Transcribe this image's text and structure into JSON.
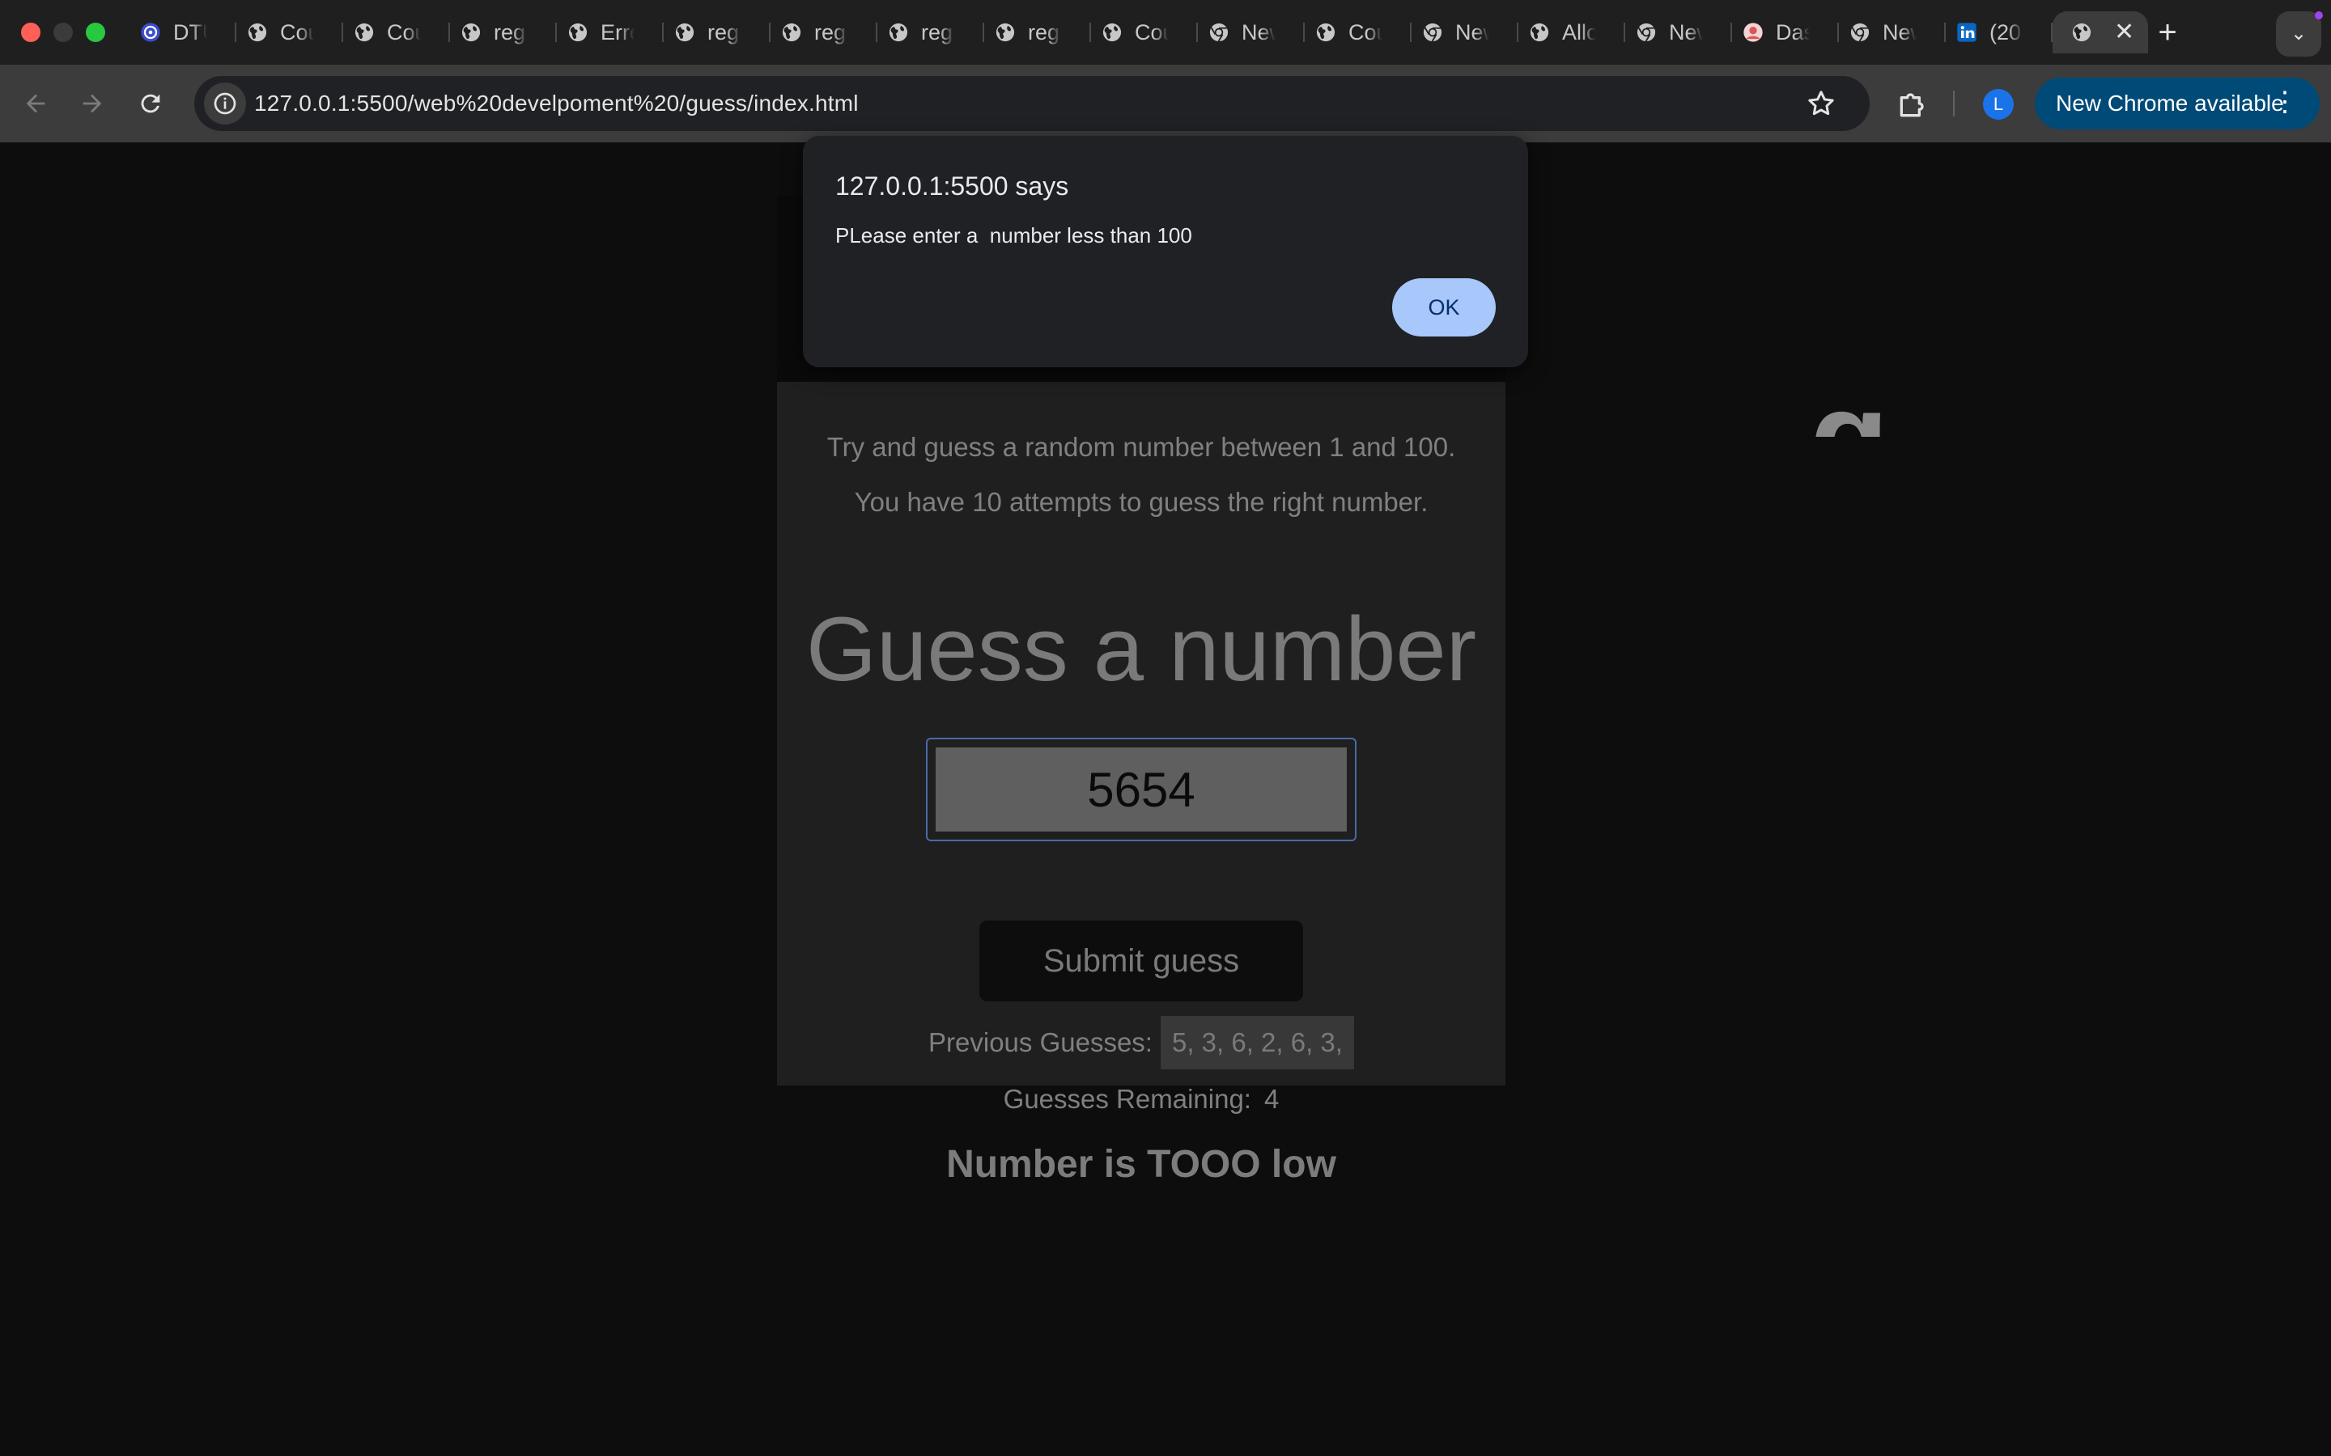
{
  "browser": {
    "tabs": [
      {
        "label": "DTU",
        "icon": "target-favicon-icon"
      },
      {
        "label": "Cou",
        "icon": "globe-favicon-icon"
      },
      {
        "label": "Cou",
        "icon": "globe-favicon-icon"
      },
      {
        "label": "reg",
        "icon": "globe-favicon-icon"
      },
      {
        "label": "Erro",
        "icon": "globe-favicon-icon"
      },
      {
        "label": "reg",
        "icon": "globe-favicon-icon"
      },
      {
        "label": "reg",
        "icon": "globe-favicon-icon"
      },
      {
        "label": "reg",
        "icon": "globe-favicon-icon"
      },
      {
        "label": "reg",
        "icon": "globe-favicon-icon"
      },
      {
        "label": "Cou",
        "icon": "globe-favicon-icon"
      },
      {
        "label": "New",
        "icon": "chrome-favicon-icon"
      },
      {
        "label": "Cou",
        "icon": "globe-favicon-icon"
      },
      {
        "label": "New",
        "icon": "chrome-favicon-icon"
      },
      {
        "label": "Allo",
        "icon": "globe-favicon-icon"
      },
      {
        "label": "New",
        "icon": "chrome-favicon-icon"
      },
      {
        "label": "Das",
        "icon": "avatar-favicon-icon"
      },
      {
        "label": "New",
        "icon": "chrome-favicon-icon"
      },
      {
        "label": "(20",
        "icon": "linkedin-favicon-icon"
      }
    ],
    "active_tab_close": "✕",
    "new_tab": "+",
    "tab_search": "⌄",
    "url": "127.0.0.1:5500/web%20develpoment%20/guess/index.html",
    "profile_initial": "L",
    "update_label": "New Chrome available",
    "update_menu": "⋮",
    "colors": {
      "tab_strip": "#1f1f1f",
      "toolbar": "#3c3c3c",
      "omnibox": "#202124",
      "update_button": "#004a77"
    }
  },
  "page": {
    "intro_line1": "Try and guess a random number between 1 and 100.",
    "intro_line2": "You have 10 attempts to guess the right number.",
    "heading": "Guess a number",
    "guess_value": "5654",
    "submit_label": "Submit guess",
    "previous_label": "Previous Guesses:",
    "previous_values": "5, 3, 6, 2, 6, 3,",
    "remaining_label": "Guesses Remaining:",
    "remaining_value": "4",
    "result_message": "Number is TOOO low",
    "title_fragment": "g"
  },
  "dialog": {
    "title": "127.0.0.1:5500 says",
    "message": "PLease enter a  number less than 100",
    "ok_label": "OK",
    "ok_color": "#a8c7fa"
  }
}
